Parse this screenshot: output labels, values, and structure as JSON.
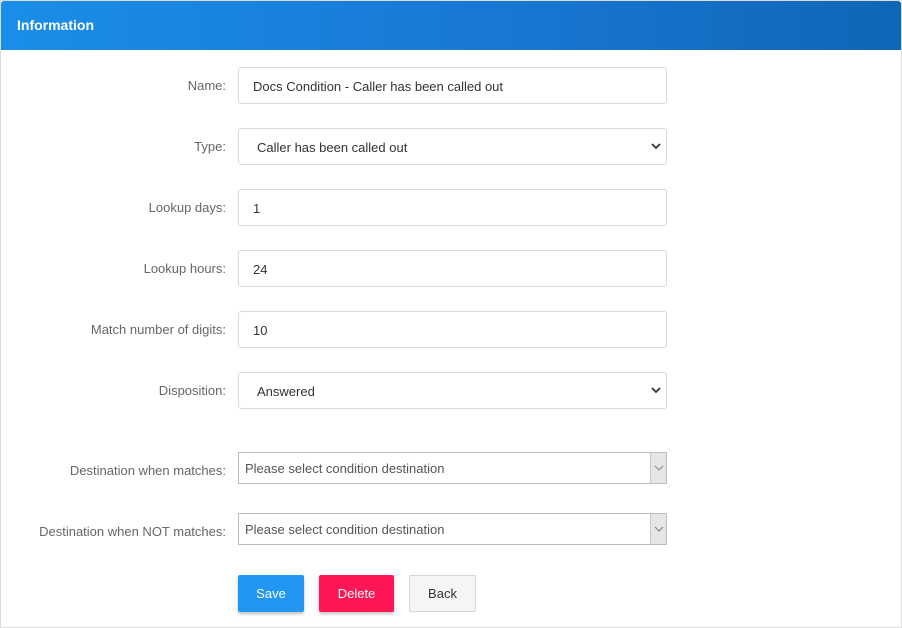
{
  "header": {
    "title": "Information"
  },
  "form": {
    "name": {
      "label": "Name:",
      "value": "Docs Condition - Caller has been called out"
    },
    "type": {
      "label": "Type:",
      "value": "Caller has been called out"
    },
    "lookup_days": {
      "label": "Lookup days:",
      "value": "1"
    },
    "lookup_hours": {
      "label": "Lookup hours:",
      "value": "24"
    },
    "match_digits": {
      "label": "Match number of digits:",
      "value": "10"
    },
    "disposition": {
      "label": "Disposition:",
      "value": "Answered"
    },
    "dest_match": {
      "label": "Destination when matches:",
      "value": "Please select condition destination"
    },
    "dest_not_match": {
      "label": "Destination when NOT matches:",
      "value": "Please select condition destination"
    }
  },
  "buttons": {
    "save": "Save",
    "delete": "Delete",
    "back": "Back"
  },
  "colors": {
    "header": "#1878d3",
    "save": "#2196f3",
    "delete": "#ff1654"
  }
}
